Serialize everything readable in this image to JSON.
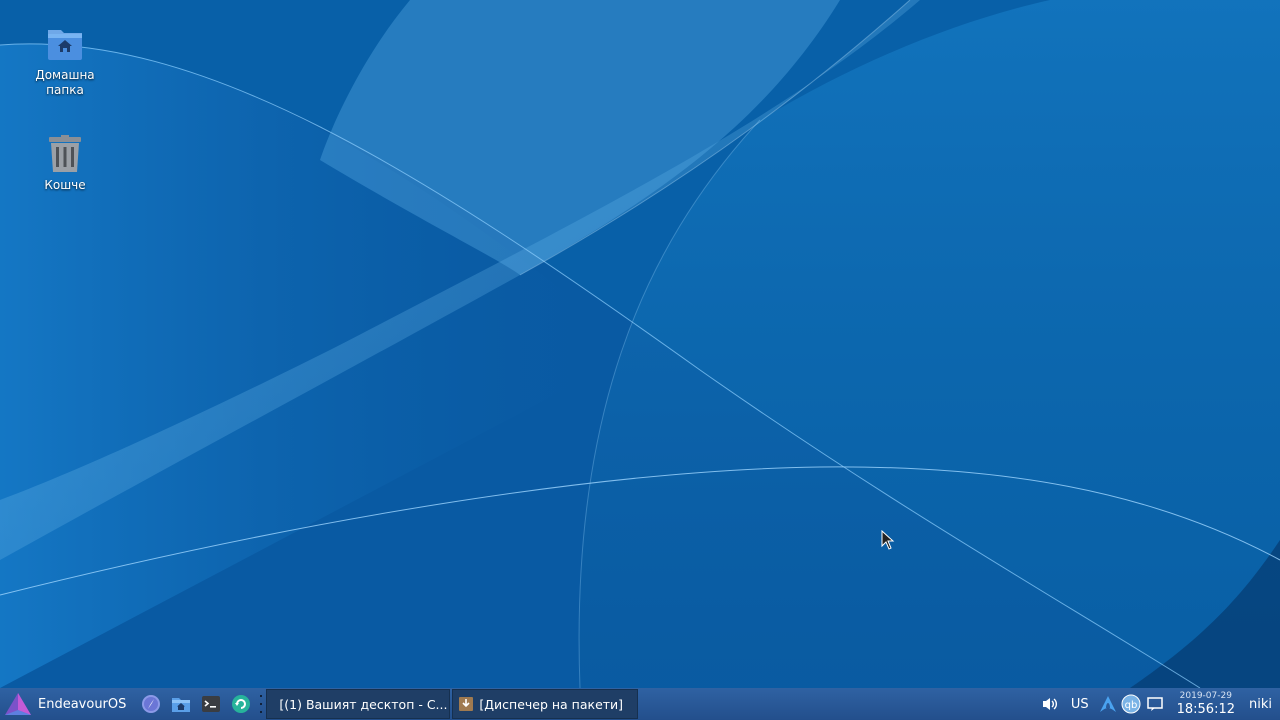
{
  "desktop": {
    "icons": [
      {
        "label_line1": "Домашна",
        "label_line2": "папка",
        "icon": "home-folder-icon"
      },
      {
        "label": "Кошче",
        "icon": "trash-icon"
      }
    ]
  },
  "panel": {
    "menu_label": "EndeavourOS",
    "launchers": [
      "web-browser-icon",
      "file-manager-icon",
      "terminal-icon",
      "update-icon"
    ],
    "tasks": [
      {
        "label": "[(1) Вашият десктоп - С...",
        "icon": "firefox-icon"
      },
      {
        "label": "[Диспечер на пакети]",
        "icon": "package-manager-icon"
      }
    ],
    "tray": {
      "volume_icon": "volume-icon",
      "keyboard_layout": "US",
      "tray_icons": [
        "arch-icon",
        "qbittorrent-icon",
        "notifications-icon"
      ],
      "qb_label": "qb"
    },
    "clock": {
      "date": "2019-07-29",
      "time": "18:56:12"
    },
    "user": "niki"
  },
  "colors": {
    "panel": "#2a5a9a",
    "wallpaper_primary": "#0a6ab8",
    "task_bg": "#1f3e66"
  }
}
